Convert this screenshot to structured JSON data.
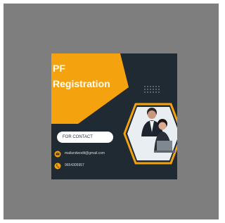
{
  "poster": {
    "title_line1": "PF",
    "title_line2": "Registration",
    "contact_label": "FOR CONTACT",
    "email": "mailandwodit@gmail.com",
    "phone": "9654305957",
    "email_icon": "envelope-icon",
    "phone_icon": "phone-icon",
    "colors": {
      "background": "#1f2a33",
      "accent": "#f5a20f",
      "frame": "#7e7e7e"
    }
  }
}
